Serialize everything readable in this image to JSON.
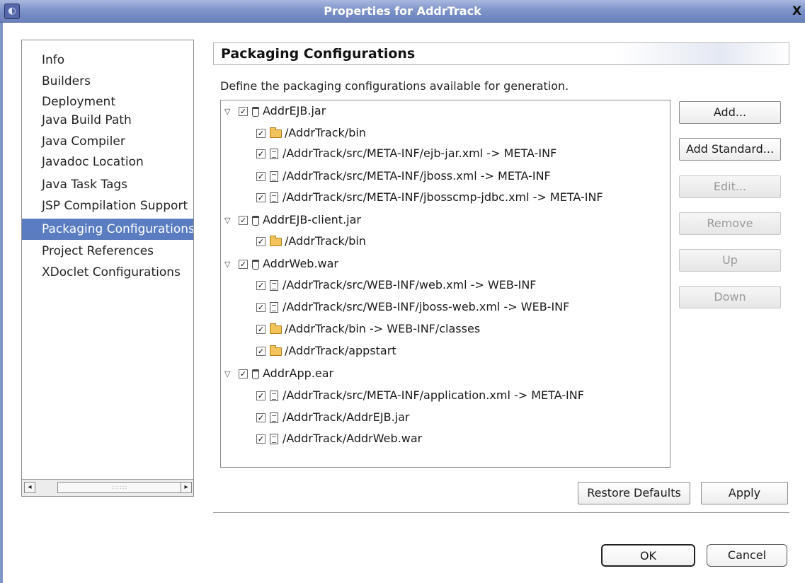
{
  "window": {
    "title": "Properties for AddrTrack",
    "app_icon": "eclipse-icon",
    "close_glyph": "X"
  },
  "nav": {
    "items": [
      {
        "label": "Info",
        "selected": false
      },
      {
        "label": "Builders",
        "selected": false
      },
      {
        "label": "Deployment",
        "selected": false
      },
      {
        "label": "Java Build Path",
        "selected": false
      },
      {
        "label": "Java Compiler",
        "selected": false
      },
      {
        "label": "Javadoc Location",
        "selected": false
      },
      {
        "label": "Java Task Tags",
        "selected": false
      },
      {
        "label": "JSP Compilation Support",
        "selected": false
      },
      {
        "label": "Packaging Configurations",
        "selected": true
      },
      {
        "label": "Project References",
        "selected": false
      },
      {
        "label": "XDoclet Configurations",
        "selected": false
      }
    ],
    "scroll_left": "◂",
    "scroll_right": "▸",
    "scroll_thumb_grip": "::::::"
  },
  "main": {
    "heading": "Packaging Configurations",
    "description": "Define the packaging configurations available for generation.",
    "tree": [
      {
        "level": 0,
        "type": "jar",
        "label": "AddrEJB.jar",
        "checked": true,
        "expanded": true
      },
      {
        "level": 1,
        "type": "folder",
        "label": "/AddrTrack/bin",
        "checked": true
      },
      {
        "level": 1,
        "type": "file",
        "label": "/AddrTrack/src/META-INF/ejb-jar.xml -> META-INF",
        "checked": true
      },
      {
        "level": 1,
        "type": "file",
        "label": "/AddrTrack/src/META-INF/jboss.xml -> META-INF",
        "checked": true
      },
      {
        "level": 1,
        "type": "file",
        "label": "/AddrTrack/src/META-INF/jbosscmp-jdbc.xml -> META-INF",
        "checked": true
      },
      {
        "level": 0,
        "type": "jar",
        "label": "AddrEJB-client.jar",
        "checked": true,
        "expanded": true
      },
      {
        "level": 1,
        "type": "folder",
        "label": "/AddrTrack/bin",
        "checked": true
      },
      {
        "level": 0,
        "type": "jar",
        "label": "AddrWeb.war",
        "checked": true,
        "expanded": true
      },
      {
        "level": 1,
        "type": "file",
        "label": "/AddrTrack/src/WEB-INF/web.xml -> WEB-INF",
        "checked": true
      },
      {
        "level": 1,
        "type": "file",
        "label": "/AddrTrack/src/WEB-INF/jboss-web.xml -> WEB-INF",
        "checked": true
      },
      {
        "level": 1,
        "type": "folder",
        "label": "/AddrTrack/bin -> WEB-INF/classes",
        "checked": true
      },
      {
        "level": 1,
        "type": "folder",
        "label": "/AddrTrack/appstart",
        "checked": true
      },
      {
        "level": 0,
        "type": "jar",
        "label": "AddrApp.ear",
        "checked": true,
        "expanded": true
      },
      {
        "level": 1,
        "type": "file",
        "label": "/AddrTrack/src/META-INF/application.xml -> META-INF",
        "checked": true
      },
      {
        "level": 1,
        "type": "file",
        "label": "/AddrTrack/AddrEJB.jar",
        "checked": true
      },
      {
        "level": 1,
        "type": "file",
        "label": "/AddrTrack/AddrWeb.war",
        "checked": true
      }
    ],
    "expander_glyph": "▽",
    "check_glyph": "✓"
  },
  "side_buttons": [
    {
      "label": "Add...",
      "enabled": true,
      "name": "add-button"
    },
    {
      "label": "Add Standard...",
      "enabled": true,
      "name": "add-standard-button"
    },
    {
      "label": "Edit...",
      "enabled": false,
      "name": "edit-button"
    },
    {
      "label": "Remove",
      "enabled": false,
      "name": "remove-button"
    },
    {
      "label": "Up",
      "enabled": false,
      "name": "up-button"
    },
    {
      "label": "Down",
      "enabled": false,
      "name": "down-button"
    }
  ],
  "actions": {
    "restore_defaults": "Restore Defaults",
    "apply": "Apply"
  },
  "dialog": {
    "ok": "OK",
    "cancel": "Cancel"
  }
}
